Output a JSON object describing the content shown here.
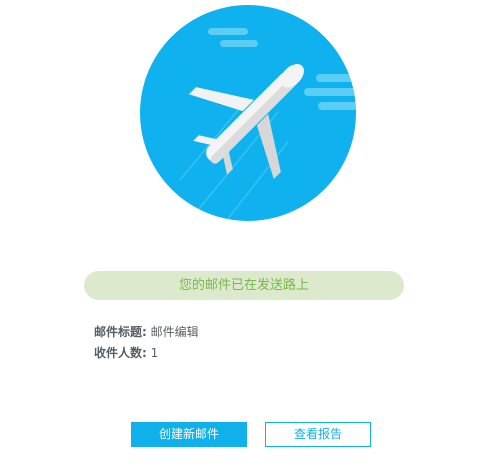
{
  "status": {
    "message": "您的邮件已在发送路上"
  },
  "details": {
    "subject_label": "邮件标题:",
    "subject_value": "邮件编辑",
    "recipients_label": "收件人数:",
    "recipients_value": "1"
  },
  "actions": {
    "create_label": "创建新邮件",
    "report_label": "查看报告"
  },
  "colors": {
    "accent": "#10b0ea",
    "status_bg": "#dde9cc",
    "status_text": "#78b94c",
    "circle": "#0fb2ef"
  },
  "icons": {
    "illustration": "airplane-icon"
  }
}
